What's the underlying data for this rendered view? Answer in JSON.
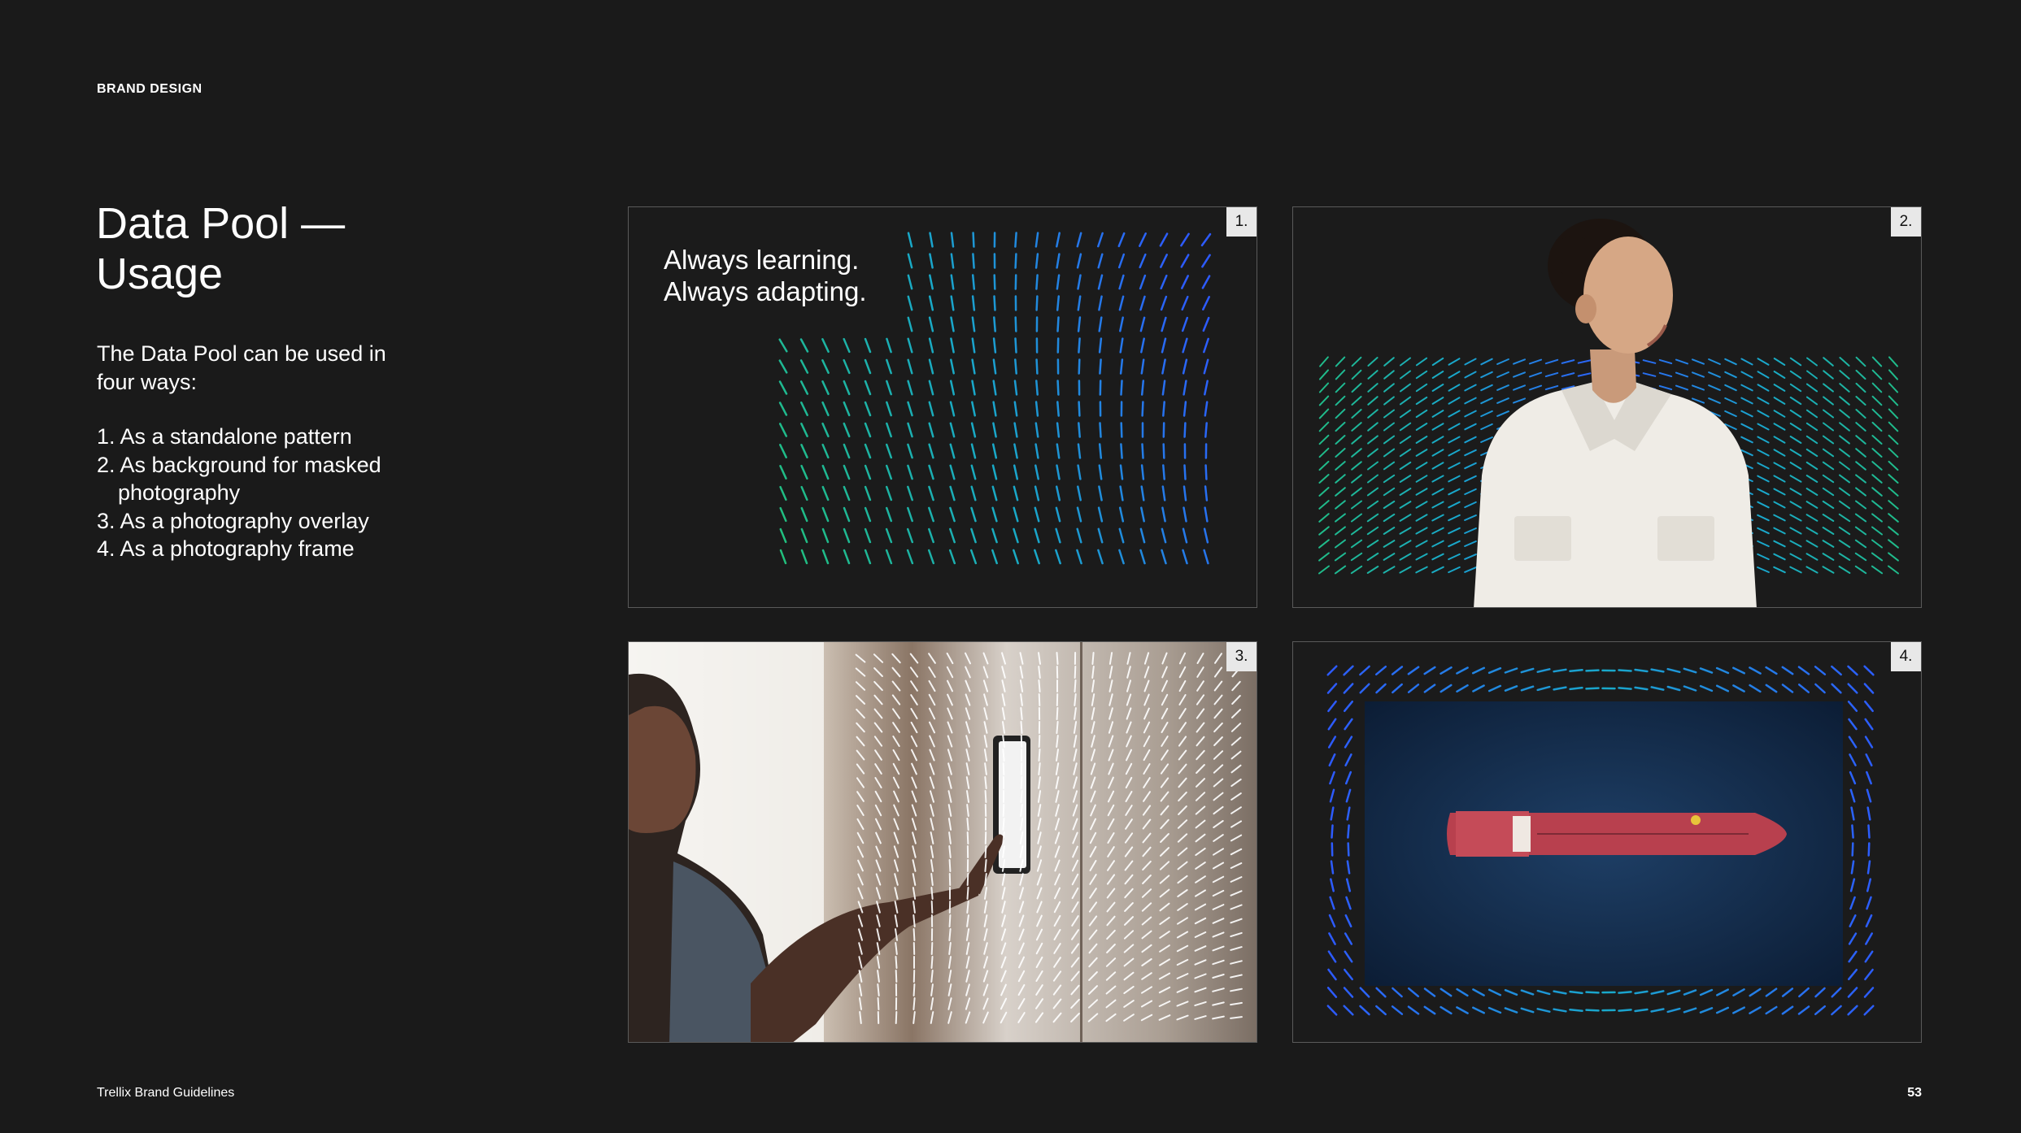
{
  "header": {
    "section": "BRAND DESIGN"
  },
  "title": "Data Pool — Usage",
  "intro": "The Data Pool can be used in four ways:",
  "ways": [
    "1. As a standalone pattern",
    "2. As background for masked photography",
    "3. As a photography overlay",
    "4. As a photography frame"
  ],
  "panels": [
    {
      "number": "1.",
      "headline_line1": "Always learning.",
      "headline_line2": "Always adapting."
    },
    {
      "number": "2."
    },
    {
      "number": "3."
    },
    {
      "number": "4."
    }
  ],
  "colors": {
    "background": "#1a1a1a",
    "pattern_green": "#22c07a",
    "pattern_teal": "#19a9c9",
    "pattern_blue": "#2d5bff",
    "frame_border": "#5a5a5a"
  },
  "footer": {
    "left": "Trellix Brand Guidelines",
    "page": "53"
  }
}
